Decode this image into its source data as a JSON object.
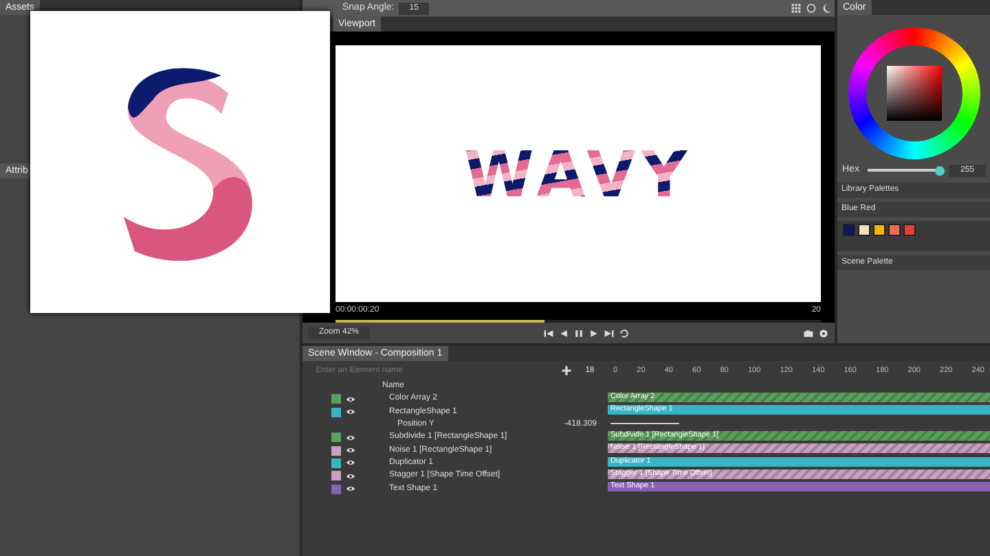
{
  "assets_panel": {
    "tab": "Assets",
    "attributes_tab": "Attrib"
  },
  "toolbar": {
    "snap_label": "Snap Angle:",
    "snap_value": "15"
  },
  "viewport": {
    "tab": "Viewport",
    "artwork_text": "WAVY",
    "timecode": "00:00:00:20",
    "frame": "20",
    "scrub": {
      "level": 0.43
    },
    "zoom": "Zoom 42%"
  },
  "color_panel": {
    "title": "Color",
    "hex_label": "Hex",
    "level": 0.97,
    "value": "255",
    "library_title": "Library Palettes",
    "palette_name": "Blue Red",
    "swatches": [
      {
        "color": "#0c1660"
      },
      {
        "color": "#f6dfb4"
      },
      {
        "color": "#f2b705"
      },
      {
        "color": "#f26b4f"
      },
      {
        "color": "#e53d35"
      }
    ],
    "scene_title": "Scene Palette"
  },
  "scene_window": {
    "tab": "Scene Window - Composition 1",
    "search": {
      "placeholder": "Enter an Element name"
    },
    "frame_field": "18",
    "name_column": "Name",
    "ruler": [
      "0",
      "20",
      "40",
      "60",
      "80",
      "100",
      "120",
      "140",
      "160",
      "180",
      "200",
      "220",
      "240"
    ],
    "layers": [
      {
        "kind": "layer",
        "name": "Color Array 2",
        "color": "#5aa05a",
        "bar": "Color Array 2",
        "hatched": true
      },
      {
        "kind": "layer",
        "name": "RectangleShape 1",
        "color": "#3ab3c8",
        "bar": "RectangleShape 1",
        "hatched": false
      },
      {
        "kind": "property",
        "name": "Position Y",
        "value": "-418.309"
      },
      {
        "kind": "layer",
        "name": "Subdivide 1 [RectangleShape 1]",
        "color": "#5aa05a",
        "bar": "Subdivide 1 [RectangleShape 1]",
        "hatched": true
      },
      {
        "kind": "layer",
        "name": "Noise 1 [RectangleShape 1]",
        "color": "#c9a0c0",
        "bar": "Noise 1 [RectangleShape 1]",
        "hatched": true
      },
      {
        "kind": "layer",
        "name": "Duplicator 1",
        "color": "#3ab3c8",
        "bar": "Duplicator 1",
        "hatched": false
      },
      {
        "kind": "layer",
        "name": "Stagger 1 [Shape Time Offset]",
        "color": "#c9a0c0",
        "bar": "Stagger 1 [Shape Time Offset]",
        "hatched": true
      },
      {
        "kind": "layer",
        "name": "Text Shape 1",
        "color": "#8a60b8",
        "bar": "Text Shape 1",
        "hatched": false
      }
    ]
  }
}
